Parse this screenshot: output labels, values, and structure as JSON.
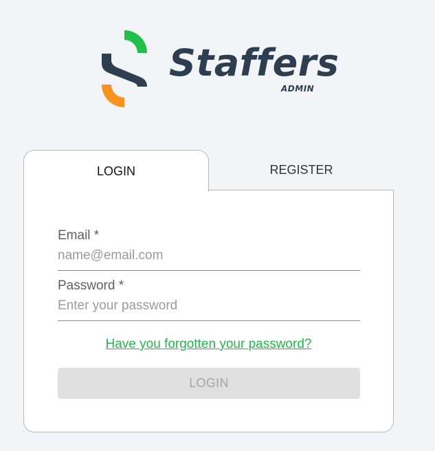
{
  "logo": {
    "wordmark": "Staffers",
    "subtitle": "ADMIN",
    "icon": "staffers-s-mark-icon",
    "colors": {
      "green": "#22c04a",
      "navy": "#2c3e50",
      "orange": "#f7931e"
    }
  },
  "tabs": [
    {
      "label": "LOGIN",
      "active": true
    },
    {
      "label": "REGISTER",
      "active": false
    }
  ],
  "form": {
    "email": {
      "label": "Email *",
      "placeholder": "name@email.com",
      "value": ""
    },
    "password": {
      "label": "Password *",
      "placeholder": "Enter your password",
      "value": ""
    },
    "forgot_link": "Have you forgotten your password?",
    "submit_label": "LOGIN",
    "submit_disabled": true
  },
  "colors": {
    "background": "#f3f4f8",
    "card": "#ffffff",
    "link": "#1fb84a",
    "button_disabled_bg": "#e0e0e0",
    "button_disabled_text": "#a5a5a5"
  }
}
